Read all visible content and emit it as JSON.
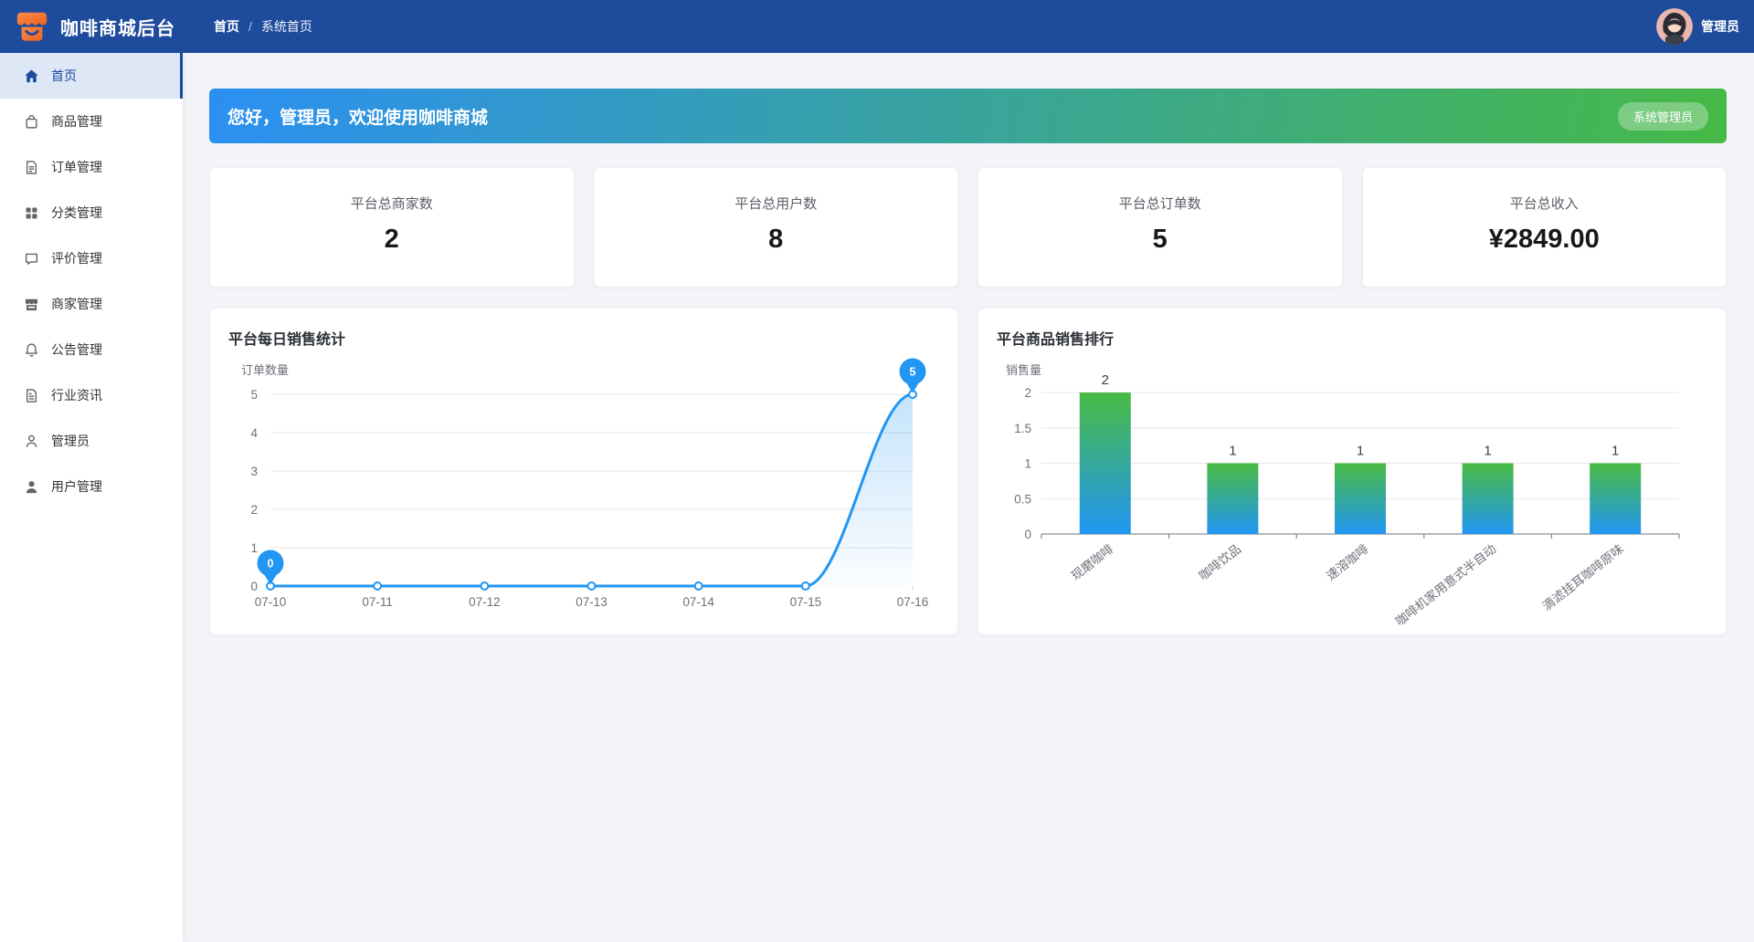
{
  "header": {
    "app_title": "咖啡商城后台",
    "breadcrumb": {
      "home": "首页",
      "separator": "/",
      "current": "系统首页"
    },
    "username": "管理员"
  },
  "sidebar": {
    "items": [
      {
        "label": "首页",
        "icon": "home-icon",
        "active": true
      },
      {
        "label": "商品管理",
        "icon": "bag-icon",
        "active": false
      },
      {
        "label": "订单管理",
        "icon": "order-icon",
        "active": false
      },
      {
        "label": "分类管理",
        "icon": "grid-icon",
        "active": false
      },
      {
        "label": "评价管理",
        "icon": "comment-icon",
        "active": false
      },
      {
        "label": "商家管理",
        "icon": "shop-icon",
        "active": false
      },
      {
        "label": "公告管理",
        "icon": "bell-icon",
        "active": false
      },
      {
        "label": "行业资讯",
        "icon": "news-icon",
        "active": false
      },
      {
        "label": "管理员",
        "icon": "admin-icon",
        "active": false
      },
      {
        "label": "用户管理",
        "icon": "user-icon",
        "active": false
      }
    ]
  },
  "banner": {
    "greeting": "您好，管理员，欢迎使用咖啡商城",
    "badge": "系统管理员"
  },
  "stats": [
    {
      "label": "平台总商家数",
      "value": "2"
    },
    {
      "label": "平台总用户数",
      "value": "8"
    },
    {
      "label": "平台总订单数",
      "value": "5"
    },
    {
      "label": "平台总收入",
      "value": "¥2849.00"
    }
  ],
  "colors": {
    "header_blue": "#1f4b9d",
    "banner_from": "#2b8ff2",
    "banner_to": "#47b946",
    "line_blue": "#2196f3",
    "bar_gradient_top": "#49bb43",
    "bar_gradient_bottom": "#2196f3",
    "axis_text": "#6e7079",
    "grid_line": "#e4e7ed"
  },
  "chart_data": [
    {
      "type": "line",
      "title": "平台每日销售统计",
      "ylabel": "订单数量",
      "xlabel": "",
      "x": [
        "07-10",
        "07-11",
        "07-12",
        "07-13",
        "07-14",
        "07-15",
        "07-16"
      ],
      "values": [
        0,
        0,
        0,
        0,
        0,
        0,
        5
      ],
      "ylim": [
        0,
        5
      ],
      "yticks": [
        0,
        1,
        2,
        3,
        4,
        5
      ],
      "grid": true,
      "legend": "none",
      "marked_points": [
        {
          "index": 0,
          "value": 0
        },
        {
          "index": 6,
          "value": 5
        }
      ]
    },
    {
      "type": "bar",
      "title": "平台商品销售排行",
      "ylabel": "销售量",
      "xlabel": "",
      "categories": [
        "现磨咖啡",
        "咖啡饮品",
        "速溶咖啡",
        "咖啡机家用意式半自动",
        "滴滤挂耳咖啡原味"
      ],
      "values": [
        2,
        1,
        1,
        1,
        1
      ],
      "ylim": [
        0,
        2
      ],
      "yticks": [
        0,
        0.5,
        1,
        1.5,
        2
      ],
      "grid": true,
      "legend": "none",
      "bar_value_labels": [
        2,
        1,
        1,
        1,
        1
      ]
    }
  ]
}
